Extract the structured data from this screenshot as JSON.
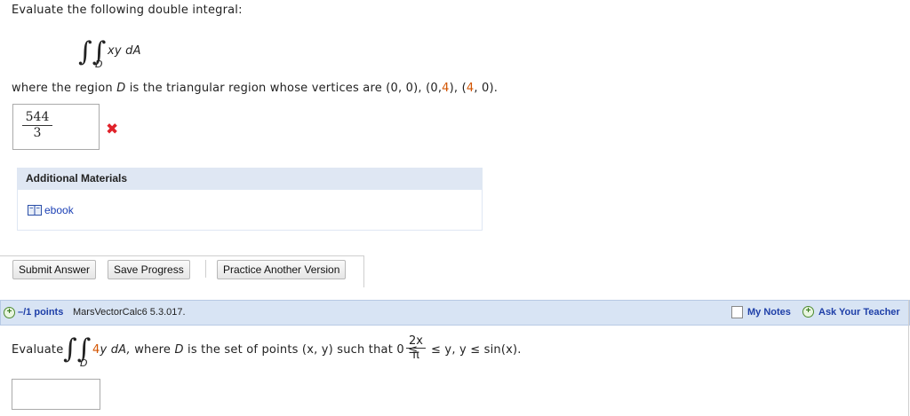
{
  "question1": {
    "prompt": "Evaluate the following double integral:",
    "integral_symbol": "∫∫",
    "region_sub": "D",
    "integrand": "xy dA",
    "description_prefix": "where the region",
    "region_name": "D",
    "description_mid": "is the triangular region whose vertices are (0, 0), (0,",
    "v_a": "4",
    "mid2": "), (",
    "v_b": "4",
    "mid3": ", 0).",
    "answer_numerator": "544",
    "answer_denominator": "3",
    "incorrect_mark": "✖"
  },
  "additional_materials": {
    "header": "Additional Materials",
    "ebook_label": "ebook"
  },
  "buttons": {
    "submit": "Submit Answer",
    "save": "Save Progress",
    "practice": "Practice Another Version"
  },
  "question2_bar": {
    "points": "–/1 points",
    "question_id": "MarsVectorCalc6 5.3.017.",
    "my_notes": "My Notes",
    "ask_teacher": "Ask Your Teacher"
  },
  "question2": {
    "evaluate": "Evaluate",
    "integral_symbol": "∫∫",
    "region_sub": "D",
    "integrand_coef": "4",
    "integrand_rest": "y dA,",
    "where": "where",
    "region_name": "D",
    "set_text": "is the set of points (x, y) such that 0 ≤",
    "frac_num": "2x",
    "frac_den": "π",
    "tail": "≤ y, y ≤ sin(x)."
  },
  "colors": {
    "incorrect": "#e0222a",
    "link": "#1a3fb5",
    "bar_bg": "#d8e4f4",
    "highlight": "#d35400"
  }
}
